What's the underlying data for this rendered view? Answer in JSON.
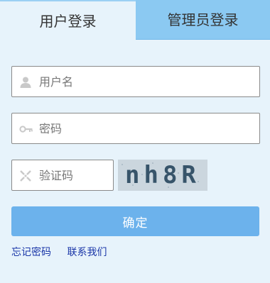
{
  "tabs": [
    {
      "label": "用户登录",
      "active": true
    },
    {
      "label": "管理员登录",
      "active": false
    }
  ],
  "form": {
    "username": {
      "placeholder": "用户名",
      "value": "",
      "icon": "user-icon"
    },
    "password": {
      "placeholder": "密码",
      "value": "",
      "icon": "key-icon"
    },
    "captcha": {
      "placeholder": "验证码",
      "value": "",
      "icon": "captcha-icon",
      "image_text": "nh8R"
    },
    "submit_label": "确定"
  },
  "links": {
    "forgot_password": "忘记密码",
    "contact_us": "联系我们"
  },
  "colors": {
    "background": "#e7f3fb",
    "inactive_tab": "#8bc9f2",
    "submit": "#6cb2ec",
    "link": "#1a36a8"
  }
}
